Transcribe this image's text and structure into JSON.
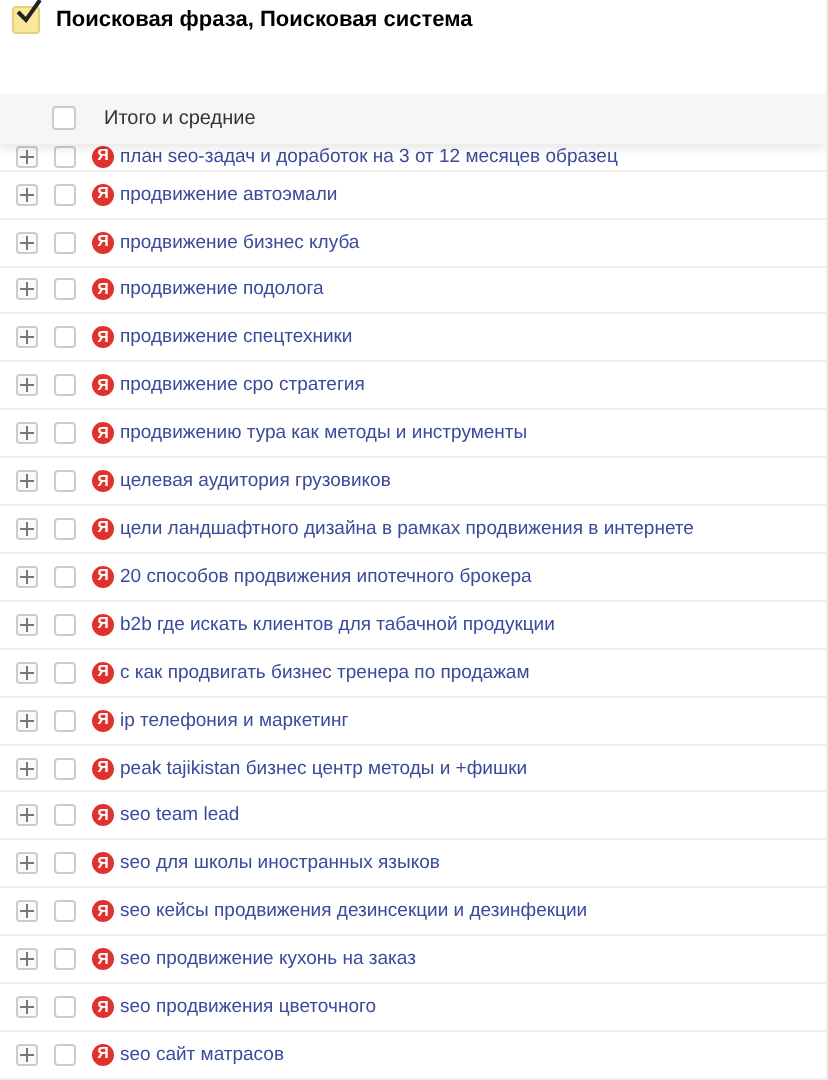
{
  "grouping": {
    "label": "Поисковая фраза, Поисковая система",
    "checked": true
  },
  "totals": {
    "label": "Итого и средние",
    "checked": false
  },
  "rows": [
    {
      "phrase": "план seo-задач и доработок на 3 от 12 месяцев образец",
      "engine": "Я",
      "expanded": false,
      "checked": false
    },
    {
      "phrase": "продвижение автоэмали",
      "engine": "Я",
      "expanded": false,
      "checked": false
    },
    {
      "phrase": "продвижение бизнес клуба",
      "engine": "Я",
      "expanded": false,
      "checked": false
    },
    {
      "phrase": "продвижение подолога",
      "engine": "Я",
      "expanded": false,
      "checked": false
    },
    {
      "phrase": "продвижение спецтехники",
      "engine": "Я",
      "expanded": false,
      "checked": false
    },
    {
      "phrase": "продвижение сро стратегия",
      "engine": "Я",
      "expanded": false,
      "checked": false
    },
    {
      "phrase": "продвижению тура как методы и инструменты",
      "engine": "Я",
      "expanded": false,
      "checked": false
    },
    {
      "phrase": "целевая аудитория грузовиков",
      "engine": "Я",
      "expanded": false,
      "checked": false
    },
    {
      "phrase": "цели ландшафтного дизайна в рамках продвижения в интернете",
      "engine": "Я",
      "expanded": false,
      "checked": false
    },
    {
      "phrase": "20 способов продвижения ипотечного брокера",
      "engine": "Я",
      "expanded": false,
      "checked": false
    },
    {
      "phrase": "b2b где искать клиентов для табачной продукции",
      "engine": "Я",
      "expanded": false,
      "checked": false
    },
    {
      "phrase": "с как продвигать бизнес тренера по продажам",
      "engine": "Я",
      "expanded": false,
      "checked": false
    },
    {
      "phrase": "ip телефония и маркетинг",
      "engine": "Я",
      "expanded": false,
      "checked": false
    },
    {
      "phrase": "peak tajikistan бизнес центр методы и +фишки",
      "engine": "Я",
      "expanded": false,
      "checked": false
    },
    {
      "phrase": "seo team lead",
      "engine": "Я",
      "expanded": false,
      "checked": false
    },
    {
      "phrase": "seo для школы иностранных языков",
      "engine": "Я",
      "expanded": false,
      "checked": false
    },
    {
      "phrase": "seo кейсы продвижения дезинсекции и дезинфекции",
      "engine": "Я",
      "expanded": false,
      "checked": false
    },
    {
      "phrase": "seo продвижение кухонь на заказ",
      "engine": "Я",
      "expanded": false,
      "checked": false
    },
    {
      "phrase": "seo продвижения цветочного",
      "engine": "Я",
      "expanded": false,
      "checked": false
    },
    {
      "phrase": "seo сайт матрасов",
      "engine": "Я",
      "expanded": false,
      "checked": false
    }
  ]
}
